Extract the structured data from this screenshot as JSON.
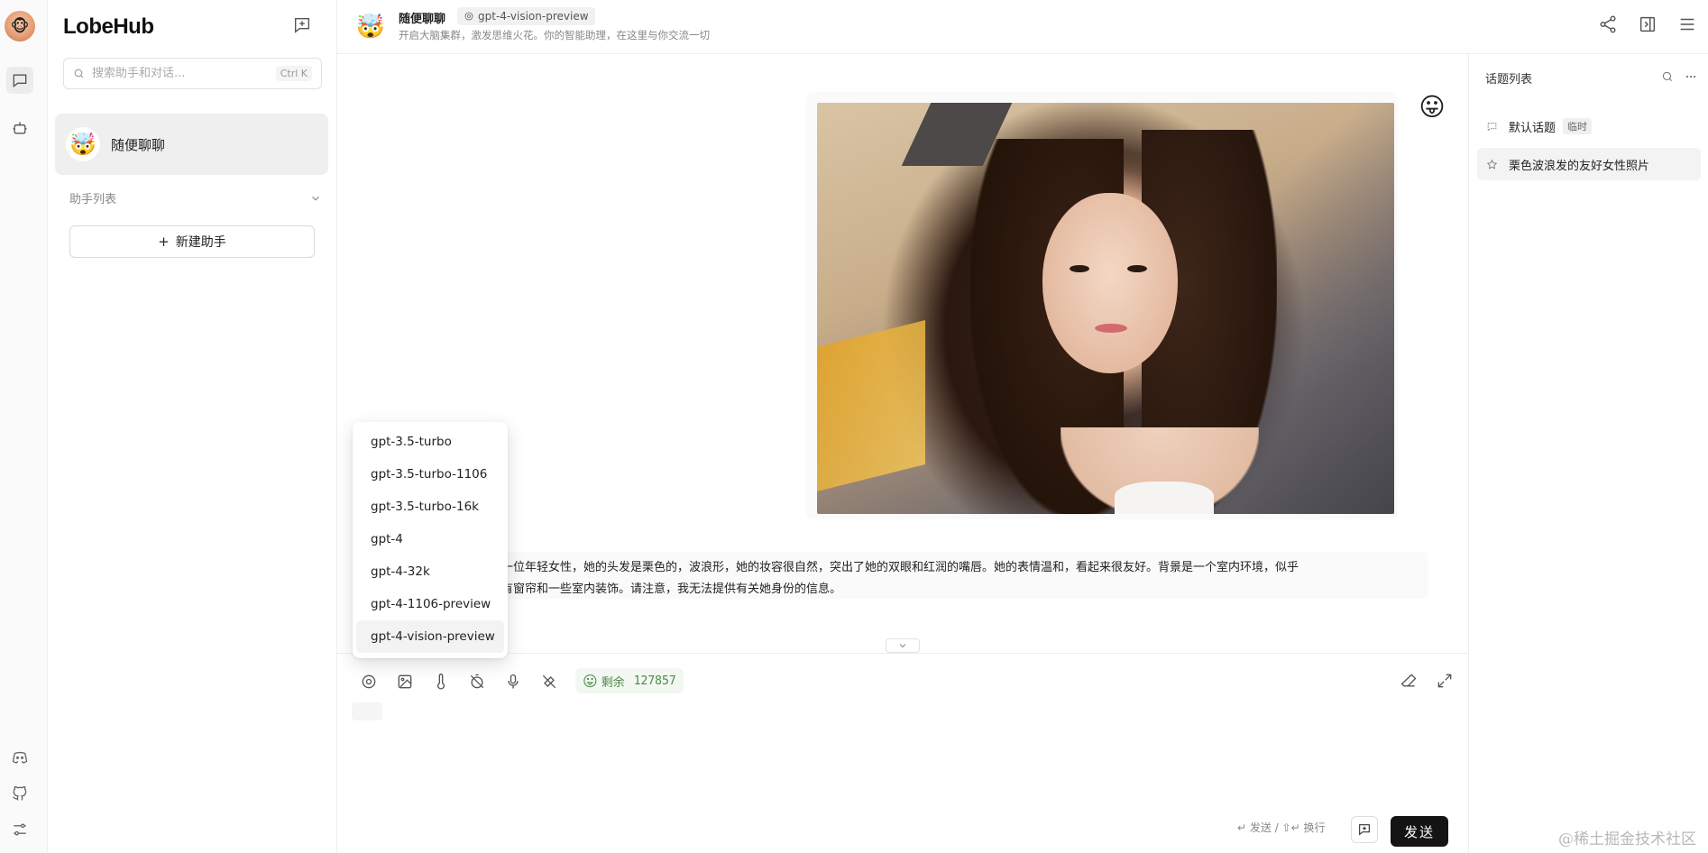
{
  "app": {
    "brand": "LobeHub"
  },
  "sidebar": {
    "search_placeholder": "搜索助手和对话...",
    "search_shortcut": "Ctrl K",
    "session": {
      "name": "随便聊聊"
    },
    "group_label": "助手列表",
    "new_agent_label": "新建助手"
  },
  "header": {
    "title": "随便聊聊",
    "model": "gpt-4-vision-preview",
    "description": "开启大脑集群，激发思维火花。你的智能助理，在这里与你交流一切"
  },
  "chat": {
    "reply_line1": "一位年轻女性，她的头发是栗色的，波浪形，她的妆容很自然，突出了她的双眼和红润的嘴唇。她的表情温和，看起来很友好。背景是一个室内环境，似乎",
    "reply_line2": "有窗帘和一些室内装饰。请注意，我无法提供有关她身份的信息。"
  },
  "model_menu": {
    "options": [
      "gpt-3.5-turbo",
      "gpt-3.5-turbo-1106",
      "gpt-3.5-turbo-16k",
      "gpt-4",
      "gpt-4-32k",
      "gpt-4-1106-preview",
      "gpt-4-vision-preview"
    ],
    "selected": "gpt-4-vision-preview"
  },
  "input": {
    "tokens_label": "剩余",
    "tokens_value": "127857",
    "hint": "↵ 发送 / ⇧↵ 换行",
    "send_label": "发送"
  },
  "topics": {
    "title": "话题列表",
    "items": [
      {
        "label": "默认话题",
        "tag": "临时"
      },
      {
        "label": "栗色波浪发的友好女性照片"
      }
    ]
  },
  "watermark": "@稀土掘金技术社区",
  "icons": {
    "chat_tab": "chat-bubble-icon",
    "agent_tab": "bot-icon",
    "discord": "discord-icon",
    "github": "github-icon",
    "settings": "settings-sliders-icon"
  }
}
